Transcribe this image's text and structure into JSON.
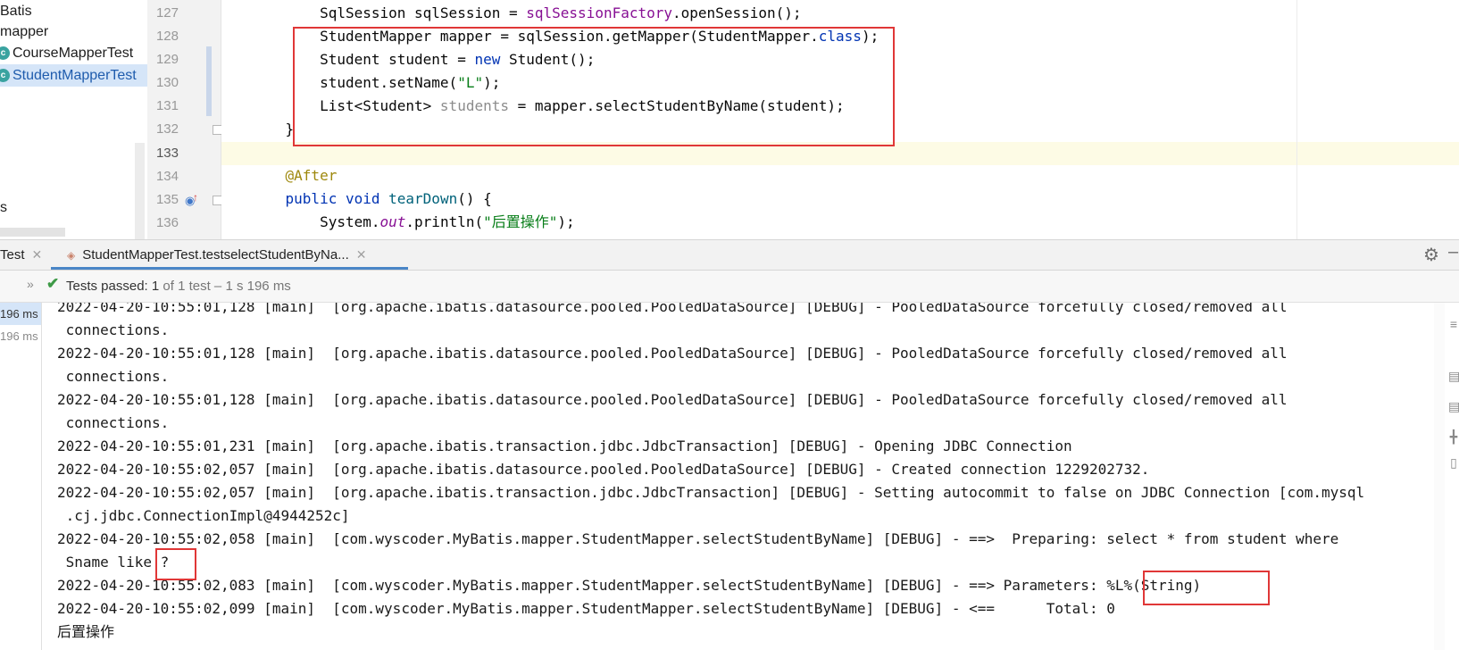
{
  "project_tree": {
    "items": [
      {
        "label": "Batis",
        "selected": false,
        "icon": ""
      },
      {
        "label": "mapper",
        "selected": false,
        "icon": ""
      },
      {
        "label": "CourseMapperTest",
        "selected": false,
        "icon": "test-class-icon"
      },
      {
        "label": "StudentMapperTest",
        "selected": true,
        "icon": "test-class-icon"
      },
      {
        "label": "s",
        "selected": false,
        "icon": ""
      }
    ]
  },
  "editor": {
    "line_numbers": [
      "127",
      "128",
      "129",
      "130",
      "131",
      "132",
      "133",
      "134",
      "135",
      "136"
    ],
    "lines": [
      {
        "indent": "        ",
        "parts": [
          [
            "",
            "SqlSession sqlSession = "
          ],
          [
            "f",
            "sqlSessionFactory"
          ],
          [
            "",
            ".openSession();"
          ]
        ]
      },
      {
        "indent": "        ",
        "parts": [
          [
            "",
            "StudentMapper mapper = sqlSession.getMapper(StudentMapper."
          ],
          [
            "k",
            "class"
          ],
          [
            "",
            ");"
          ]
        ]
      },
      {
        "indent": "        ",
        "parts": [
          [
            "",
            "Student student = "
          ],
          [
            "k",
            "new"
          ],
          [
            "",
            " Student();"
          ]
        ]
      },
      {
        "indent": "        ",
        "parts": [
          [
            "",
            "student.setName("
          ],
          [
            "s",
            "\"L\""
          ],
          [
            "",
            ");"
          ]
        ]
      },
      {
        "indent": "        ",
        "parts": [
          [
            "",
            "List<Student> "
          ],
          [
            "u",
            "students"
          ],
          [
            "",
            " = mapper.selectStudentByName(student);"
          ]
        ]
      },
      {
        "indent": "    ",
        "parts": [
          [
            "",
            "}"
          ]
        ]
      },
      {
        "indent": "",
        "parts": [
          [
            "",
            ""
          ]
        ]
      },
      {
        "indent": "    ",
        "parts": [
          [
            "a",
            "@After"
          ]
        ]
      },
      {
        "indent": "    ",
        "parts": [
          [
            "k",
            "public"
          ],
          [
            "",
            " "
          ],
          [
            "k",
            "void"
          ],
          [
            "",
            " "
          ],
          [
            "m",
            "tearDown"
          ],
          [
            "",
            "() {"
          ]
        ]
      },
      {
        "indent": "        ",
        "parts": [
          [
            "",
            "System."
          ],
          [
            "i",
            "out"
          ],
          [
            "",
            ".println("
          ],
          [
            "s",
            "\"后置操作\""
          ],
          [
            "",
            ");"
          ]
        ]
      }
    ]
  },
  "run_window": {
    "tabs": [
      {
        "label": "Test",
        "active": false
      },
      {
        "label": "StudentMapperTest.testselectStudentByNa...",
        "active": true
      }
    ],
    "status": {
      "passed_label": "Tests passed: ",
      "passed_count": "1",
      "passed_detail": " of 1 test – 1 s 196 ms"
    },
    "test_times": [
      "196 ms",
      "196 ms"
    ],
    "console_lines": [
      "2022-04-20-10:55:01,128 [main]  [org.apache.ibatis.datasource.pooled.PooledDataSource] [DEBUG] - PooledDataSource forcefully closed/removed all",
      " connections.",
      "2022-04-20-10:55:01,128 [main]  [org.apache.ibatis.datasource.pooled.PooledDataSource] [DEBUG] - PooledDataSource forcefully closed/removed all",
      " connections.",
      "2022-04-20-10:55:01,128 [main]  [org.apache.ibatis.datasource.pooled.PooledDataSource] [DEBUG] - PooledDataSource forcefully closed/removed all",
      " connections.",
      "2022-04-20-10:55:01,231 [main]  [org.apache.ibatis.transaction.jdbc.JdbcTransaction] [DEBUG] - Opening JDBC Connection",
      "2022-04-20-10:55:02,057 [main]  [org.apache.ibatis.datasource.pooled.PooledDataSource] [DEBUG] - Created connection 1229202732.",
      "2022-04-20-10:55:02,057 [main]  [org.apache.ibatis.transaction.jdbc.JdbcTransaction] [DEBUG] - Setting autocommit to false on JDBC Connection [com.mysql",
      " .cj.jdbc.ConnectionImpl@4944252c]",
      "2022-04-20-10:55:02,058 [main]  [com.wyscoder.MyBatis.mapper.StudentMapper.selectStudentByName] [DEBUG] - ==>  Preparing: select * from student where",
      " Sname like ?",
      "2022-04-20-10:55:02,083 [main]  [com.wyscoder.MyBatis.mapper.StudentMapper.selectStudentByName] [DEBUG] - ==> Parameters: %L%(String)",
      "2022-04-20-10:55:02,099 [main]  [com.wyscoder.MyBatis.mapper.StudentMapper.selectStudentByName] [DEBUG] - <==      Total: 0",
      "后置操作"
    ]
  },
  "colors": {
    "highlight_red": "#e03737",
    "pass_green": "#3e9a47",
    "keyword_blue": "#0033b3",
    "string_green": "#067d17"
  }
}
